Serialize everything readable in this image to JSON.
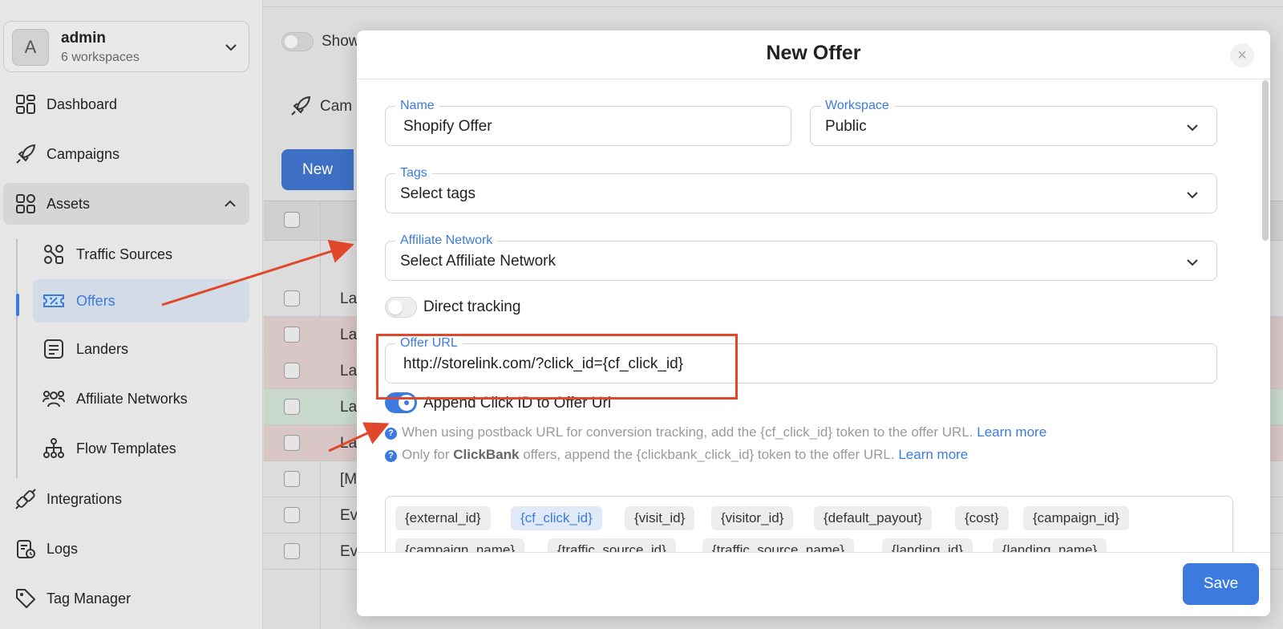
{
  "workspace": {
    "avatar": "A",
    "name": "admin",
    "sub": "6 workspaces"
  },
  "nav": {
    "dashboard": "Dashboard",
    "campaigns": "Campaigns",
    "assets": "Assets",
    "traffic_sources": "Traffic Sources",
    "offers": "Offers",
    "landers": "Landers",
    "affiliate_networks": "Affiliate Networks",
    "flow_templates": "Flow Templates",
    "integrations": "Integrations",
    "logs": "Logs",
    "tag_manager": "Tag Manager"
  },
  "background": {
    "show_label": "Show",
    "campaigns_tab": "Cam",
    "new_button": "New",
    "rows": [
      "La",
      "La",
      "La",
      "La",
      "La",
      "[M",
      "Ev",
      "Ev"
    ]
  },
  "modal": {
    "title": "New Offer",
    "close": "×",
    "name": {
      "label": "Name",
      "value": "Shopify Offer"
    },
    "workspace": {
      "label": "Workspace",
      "value": "Public"
    },
    "tags": {
      "label": "Tags",
      "value": "Select tags"
    },
    "affiliate_network": {
      "label": "Affiliate Network",
      "value": "Select Affiliate Network"
    },
    "direct_tracking": {
      "label": "Direct tracking",
      "on": false
    },
    "offer_url": {
      "label": "Offer URL",
      "value": "http://storelink.com/?click_id={cf_click_id}"
    },
    "append_click_id": {
      "label": "Append Click ID to Offer Url",
      "on": true
    },
    "help1": {
      "text": "When using postback URL for conversion tracking, add the {cf_click_id} token to the offer URL.",
      "link": "Learn more"
    },
    "help2": {
      "pre": "Only for",
      "bold": "ClickBank",
      "post": "offers, append the {clickbank_click_id} token to the offer URL.",
      "link": "Learn more"
    },
    "tokens_row1": [
      "{external_id}",
      "{cf_click_id}",
      "{visit_id}",
      "{visitor_id}",
      "{default_payout}",
      "{cost}",
      "{campaign_id}"
    ],
    "tokens_row2": [
      "{campaign_name}",
      "{traffic_source_id}",
      "{traffic_source_name}",
      "{landing_id}",
      "{landing_name}"
    ],
    "save": "Save"
  },
  "colors": {
    "accent": "#3b7be0",
    "annotation": "#e0472b"
  }
}
